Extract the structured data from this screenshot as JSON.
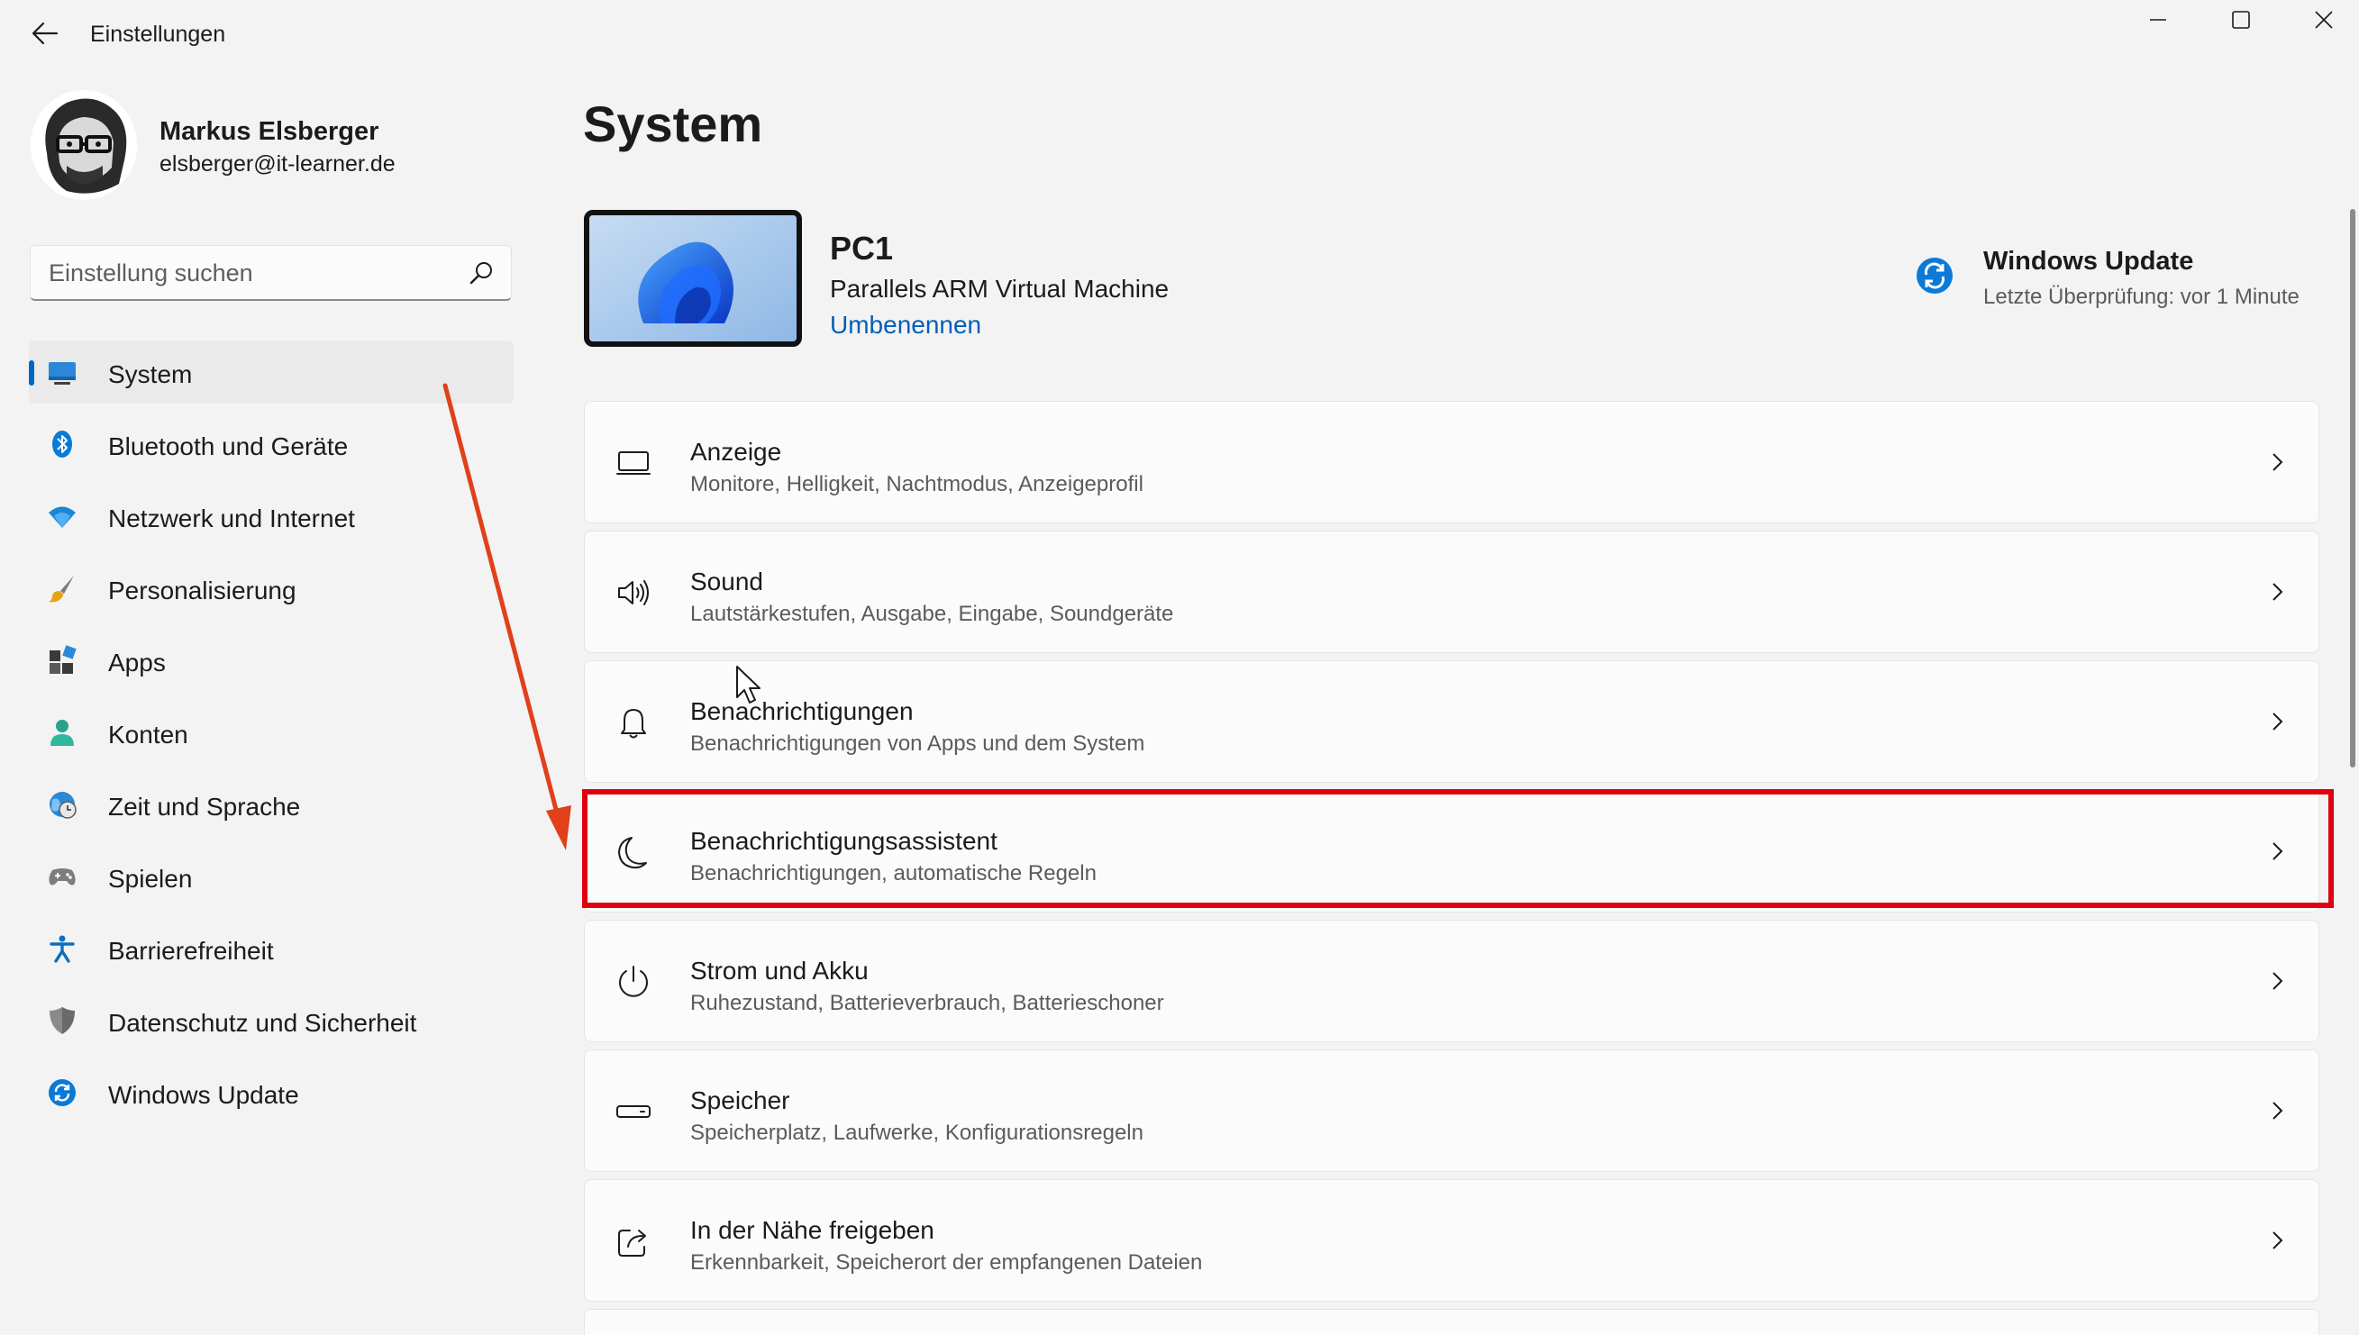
{
  "window": {
    "title": "Einstellungen",
    "controls": [
      "minimize",
      "maximize",
      "close"
    ]
  },
  "profile": {
    "name": "Markus Elsberger",
    "email": "elsberger@it-learner.de"
  },
  "search": {
    "placeholder": "Einstellung suchen"
  },
  "sidebar": {
    "items": [
      {
        "label": "System",
        "icon": "system-icon",
        "active": true
      },
      {
        "label": "Bluetooth und Geräte",
        "icon": "bluetooth-icon",
        "active": false
      },
      {
        "label": "Netzwerk und Internet",
        "icon": "wifi-icon",
        "active": false
      },
      {
        "label": "Personalisierung",
        "icon": "brush-icon",
        "active": false
      },
      {
        "label": "Apps",
        "icon": "apps-icon",
        "active": false
      },
      {
        "label": "Konten",
        "icon": "account-icon",
        "active": false
      },
      {
        "label": "Zeit und Sprache",
        "icon": "clock-globe-icon",
        "active": false
      },
      {
        "label": "Spielen",
        "icon": "gamepad-icon",
        "active": false
      },
      {
        "label": "Barrierefreiheit",
        "icon": "accessibility-icon",
        "active": false
      },
      {
        "label": "Datenschutz und Sicherheit",
        "icon": "shield-icon",
        "active": false
      },
      {
        "label": "Windows Update",
        "icon": "sync-icon",
        "active": false
      }
    ]
  },
  "main": {
    "title": "System",
    "device": {
      "name": "PC1",
      "model": "Parallels ARM Virtual Machine",
      "rename_label": "Umbenennen"
    },
    "windows_update": {
      "title": "Windows Update",
      "status": "Letzte Überprüfung: vor 1 Minute"
    },
    "cards": [
      {
        "title": "Anzeige",
        "subtitle": "Monitore, Helligkeit, Nachtmodus, Anzeigeprofil",
        "icon": "display-icon"
      },
      {
        "title": "Sound",
        "subtitle": "Lautstärkestufen, Ausgabe, Eingabe, Soundgeräte",
        "icon": "speaker-icon"
      },
      {
        "title": "Benachrichtigungen",
        "subtitle": "Benachrichtigungen von Apps und dem System",
        "icon": "bell-icon"
      },
      {
        "title": "Benachrichtigungsassistent",
        "subtitle": "Benachrichtigungen, automatische Regeln",
        "icon": "moon-icon",
        "highlighted": true
      },
      {
        "title": "Strom und Akku",
        "subtitle": "Ruhezustand, Batterieverbrauch, Batterieschoner",
        "icon": "power-icon"
      },
      {
        "title": "Speicher",
        "subtitle": "Speicherplatz, Laufwerke, Konfigurationsregeln",
        "icon": "storage-icon"
      },
      {
        "title": "In der Nähe freigeben",
        "subtitle": "Erkennbarkeit, Speicherort der empfangenen Dateien",
        "icon": "share-icon"
      }
    ]
  },
  "colors": {
    "accent": "#0067c0",
    "link": "#005fb8",
    "highlight": "#e00010",
    "arrow": "#e0401a",
    "background": "#f3f3f3",
    "card": "#fbfbfb"
  }
}
